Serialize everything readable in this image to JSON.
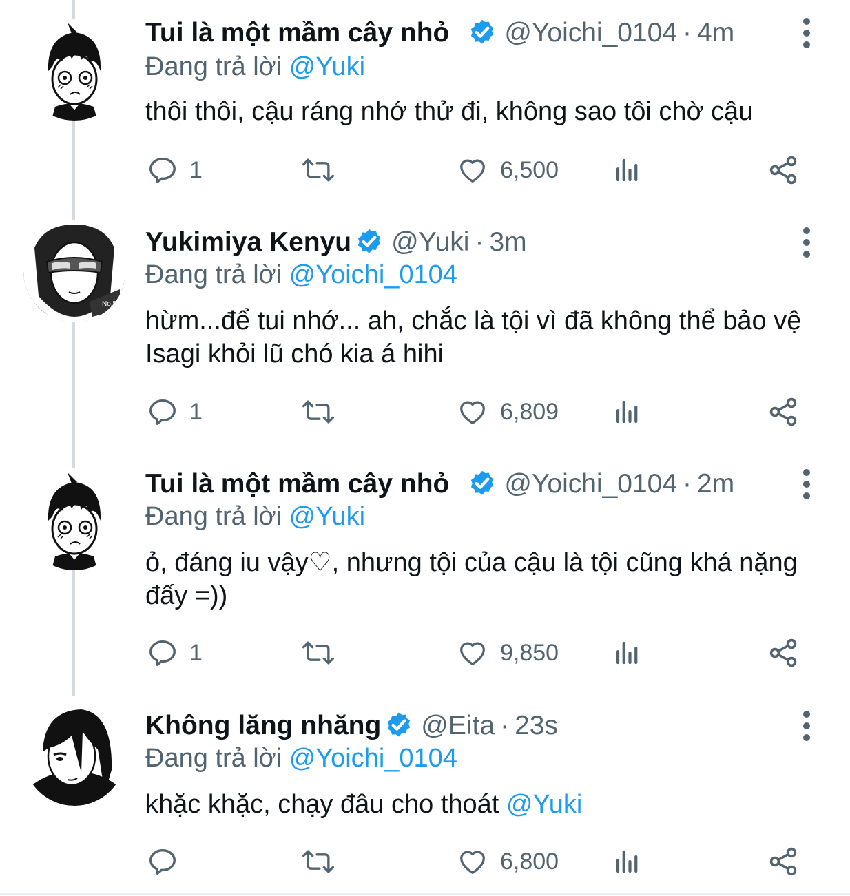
{
  "accent_color": "#1d9bf0",
  "tweets": [
    {
      "name": "Tui là một mầm cây nhỏ",
      "handle": "@Yoichi_0104",
      "time": "4m",
      "reply_prefix": "Đang trả lời",
      "reply_to": "@Yuki",
      "text": "thôi thôi, cậu ráng nhớ thử đi, không sao tôi chờ cậu",
      "reply_count": "1",
      "like_count": "6,500"
    },
    {
      "name": "Yukimiya Kenyu",
      "handle": "@Yuki",
      "time": "3m",
      "reply_prefix": "Đang trả lời",
      "reply_to": "@Yoichi_0104",
      "text": "hừm...để tui nhớ... ah, chắc là tội vì đã không thể bảo vệ Isagi khỏi lũ chó kia á hihi",
      "reply_count": "1",
      "like_count": "6,809"
    },
    {
      "name": "Tui là một mầm cây nhỏ",
      "handle": "@Yoichi_0104",
      "time": "2m",
      "reply_prefix": "Đang trả lời",
      "reply_to": "@Yuki",
      "text": "ỏ, đáng iu vậy♡,  nhưng tội của cậu là tội cũng khá nặng đấy =))",
      "reply_count": "1",
      "like_count": "9,850"
    },
    {
      "name": "Không lăng nhăng",
      "handle": "@Eita",
      "time": "23s",
      "reply_prefix": "Đang trả lời",
      "reply_to": "@Yoichi_0104",
      "text": "khặc khặc, chạy đâu cho thoát ",
      "text_mention": "@Yuki",
      "reply_count": "",
      "like_count": "6,800"
    }
  ]
}
